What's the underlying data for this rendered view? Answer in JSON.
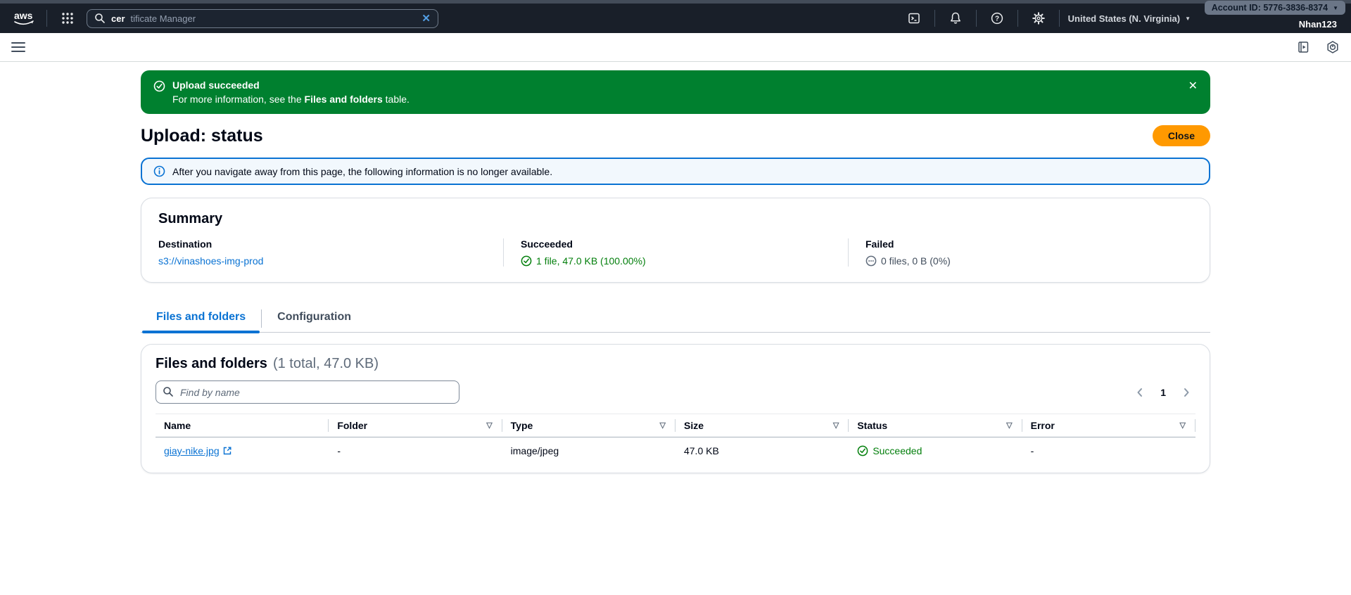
{
  "topnav": {
    "logo_text": "aws",
    "search_typed": "cer",
    "search_completion": "tificate Manager",
    "region_label": "United States (N. Virginia)",
    "account_badge": "Account ID: 5776-3836-8374",
    "username": "Nhan123"
  },
  "flash": {
    "title": "Upload succeeded",
    "message_prefix": "For more information, see the ",
    "message_bold": "Files and folders",
    "message_suffix": " table."
  },
  "page": {
    "title": "Upload: status",
    "close_button": "Close"
  },
  "info_banner": {
    "text": "After you navigate away from this page, the following information is no longer available."
  },
  "summary": {
    "title": "Summary",
    "destination_label": "Destination",
    "destination_value": "s3://vinashoes-img-prod",
    "succeeded_label": "Succeeded",
    "succeeded_value": "1 file, 47.0 KB (100.00%)",
    "failed_label": "Failed",
    "failed_value": "0 files, 0 B (0%)"
  },
  "tabs": {
    "files": "Files and folders",
    "configuration": "Configuration"
  },
  "files_panel": {
    "title": "Files and folders",
    "count_text": "(1 total, 47.0 KB)",
    "search_placeholder": "Find by name",
    "page_number": "1"
  },
  "table": {
    "headers": [
      "Name",
      "Folder",
      "Type",
      "Size",
      "Status",
      "Error"
    ],
    "rows": [
      {
        "name": "giay-nike.jpg",
        "folder": "-",
        "type": "image/jpeg",
        "size": "47.0 KB",
        "status": "Succeeded",
        "error": "-"
      }
    ]
  },
  "icons": {
    "close": "✕",
    "clear": "✕",
    "caret": "▼",
    "filter": "▽"
  },
  "colors": {
    "accent_blue": "#0972d3",
    "success_green": "#037f0c",
    "flash_green": "#00802f",
    "primary_orange": "#ff9900",
    "topnav_bg": "#191f29"
  }
}
